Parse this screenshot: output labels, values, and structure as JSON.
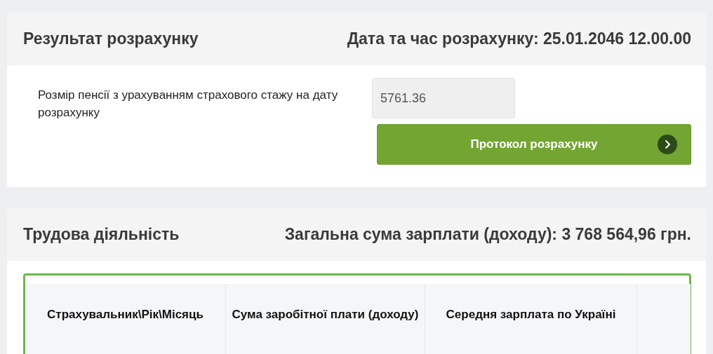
{
  "result": {
    "title": "Результат розрахунку",
    "datetime": "Дата та час розрахунку: 25.01.2046 12.00.00",
    "pension_label": "Розмір пенсії з урахуванням страхового стажу на дату розрахунку",
    "pension_value": "5761.36",
    "protocol_button": "Протокол розрахунку"
  },
  "work": {
    "title": "Трудова діяльність",
    "total": "Загальна сума зарплати (доходу): 3 768 564,96 грн.",
    "table": {
      "columns": [
        "Страхувальник\\Рік\\Місяць",
        "Сума заробітної плати (доходу)",
        "Середня зарплата по Україні"
      ]
    }
  }
}
